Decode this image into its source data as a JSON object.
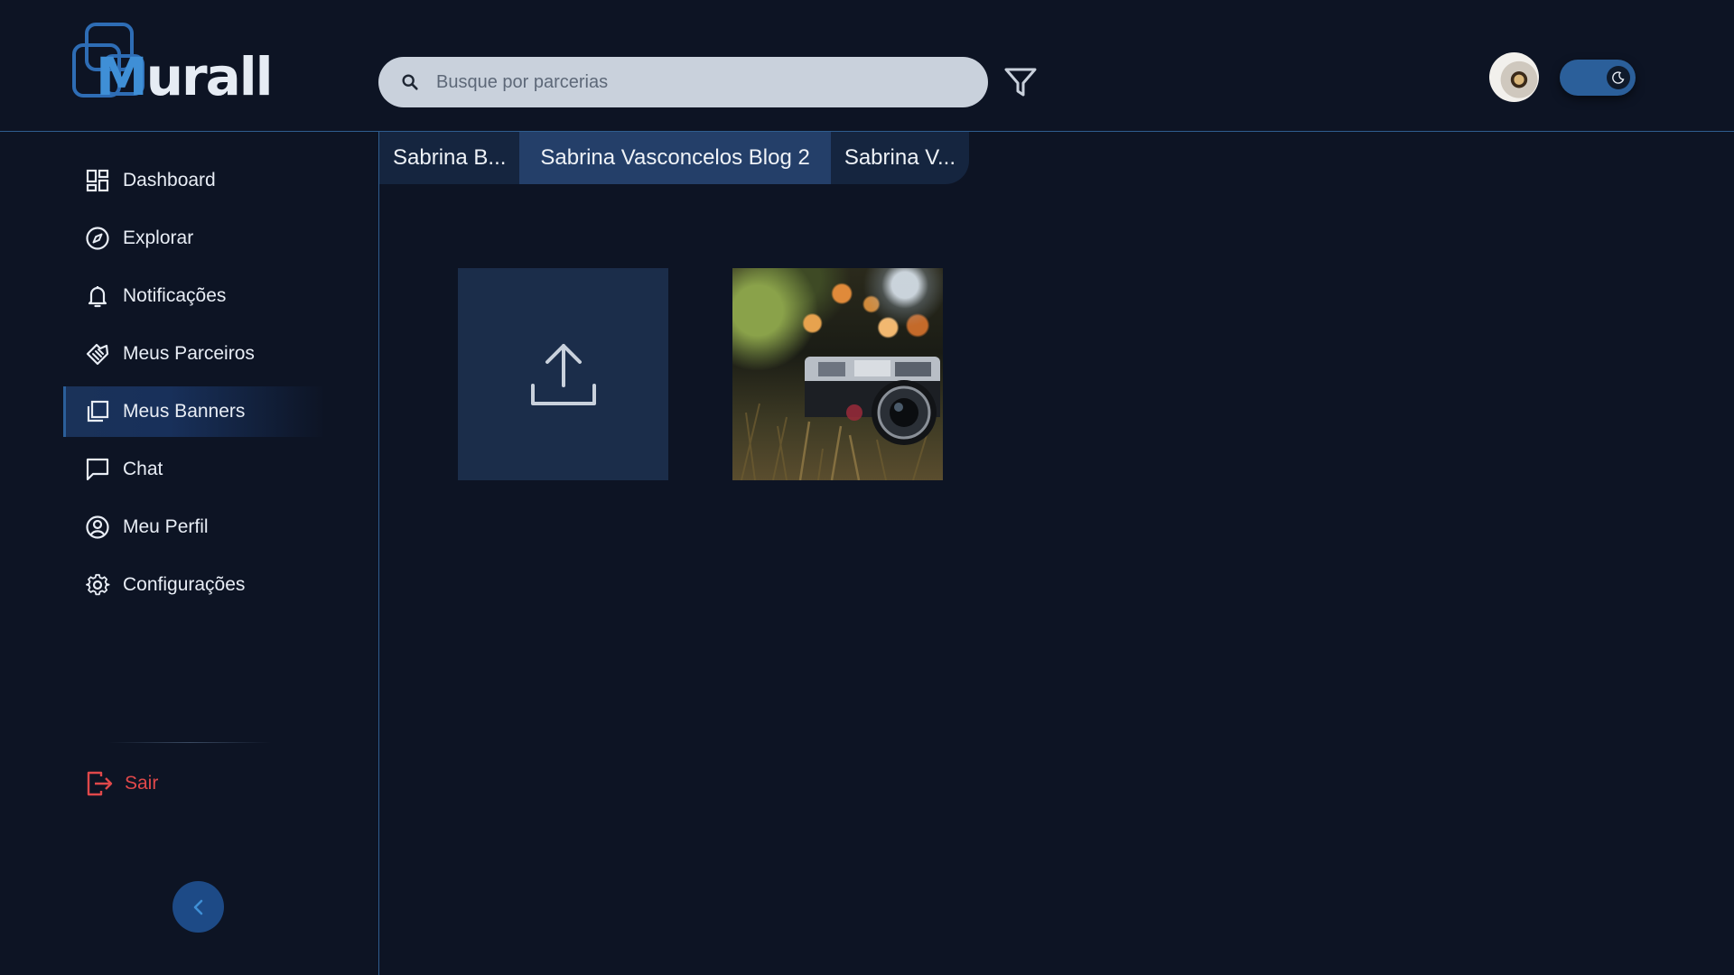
{
  "app": {
    "logo_text_m": "M",
    "logo_text_rest": "urall"
  },
  "header": {
    "search_placeholder": "Busque por parcerias",
    "filter_icon": "filter-icon",
    "avatar_icon": "user-avatar",
    "theme_toggle_icon": "moon-icon",
    "theme_mode": "dark"
  },
  "sidebar": {
    "items": [
      {
        "label": "Dashboard",
        "icon": "dashboard-icon"
      },
      {
        "label": "Explorar",
        "icon": "compass-icon"
      },
      {
        "label": "Notificações",
        "icon": "bell-icon"
      },
      {
        "label": "Meus Parceiros",
        "icon": "handshake-icon"
      },
      {
        "label": "Meus Banners",
        "icon": "banners-icon",
        "active": true
      },
      {
        "label": "Chat",
        "icon": "chat-icon"
      },
      {
        "label": "Meu Perfil",
        "icon": "profile-icon"
      },
      {
        "label": "Configurações",
        "icon": "gear-icon"
      }
    ],
    "logout_label": "Sair",
    "collapse_icon": "chevron-left-icon"
  },
  "tabs": [
    {
      "label": "Sabrina B...",
      "active": false
    },
    {
      "label": "Sabrina Vasconcelos Blog 2",
      "active": true
    },
    {
      "label": "Sabrina V...",
      "active": false
    }
  ],
  "content": {
    "upload_icon": "upload-icon",
    "banners": [
      {
        "description": "camera-photo",
        "icon": "image"
      }
    ]
  },
  "colors": {
    "background": "#0d1424",
    "accent": "#2b5f9a",
    "active_tab": "#243f69",
    "logout": "#e0484a"
  }
}
